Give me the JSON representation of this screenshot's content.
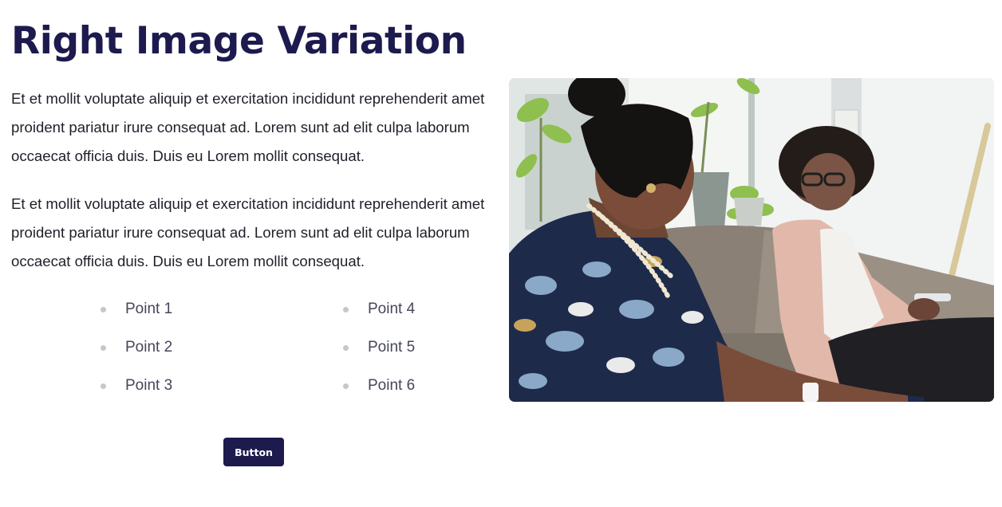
{
  "section": {
    "title": "Right Image Variation",
    "paragraphs": [
      "Et et mollit voluptate aliquip et exercitation incididunt reprehenderit amet proident pariatur irure consequat ad. Lorem sunt ad elit culpa laborum occaecat officia duis. Duis eu Lorem mollit consequat.",
      "Et et mollit voluptate aliquip et exercitation incididunt reprehenderit amet proident pariatur irure consequat ad. Lorem sunt ad elit culpa laborum occaecat officia duis. Duis eu Lorem mollit consequat."
    ],
    "points": [
      "Point 1",
      "Point 2",
      "Point 3",
      "Point 4",
      "Point 5",
      "Point 6"
    ],
    "button_label": "Button"
  },
  "colors": {
    "heading": "#1d1a4e",
    "button_bg": "#1d1a4e",
    "button_text": "#ffffff",
    "body_text": "#1f1f2a",
    "point_text": "#45475a",
    "bullet": "#c6c7cc"
  },
  "image": {
    "subject": "two women talking on a sofa beside a window with potted plants"
  }
}
